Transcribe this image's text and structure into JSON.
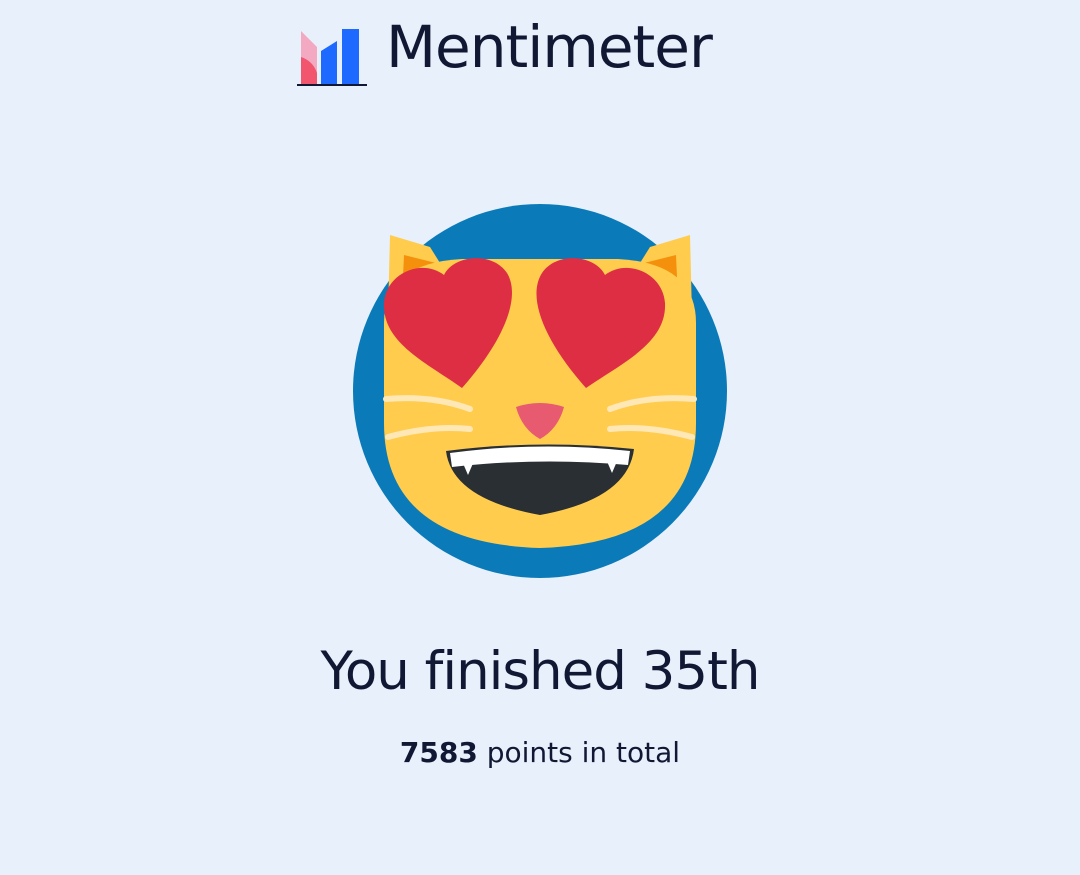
{
  "brand": {
    "name": "Mentimeter",
    "logo_icon": "mentimeter-logo-icon"
  },
  "avatar": {
    "icon": "smiling-cat-heart-eyes-icon",
    "background_color": "#0A7BB8"
  },
  "result": {
    "title": "You finished 35th",
    "points_value": "7583",
    "points_label": "points in total"
  },
  "colors": {
    "page_background": "#E8F0FC",
    "text": "#101834",
    "cat_face": "#FFCC4D",
    "hearts": "#DD2E44",
    "nose": "#E75A70",
    "mouth": "#292F33"
  }
}
